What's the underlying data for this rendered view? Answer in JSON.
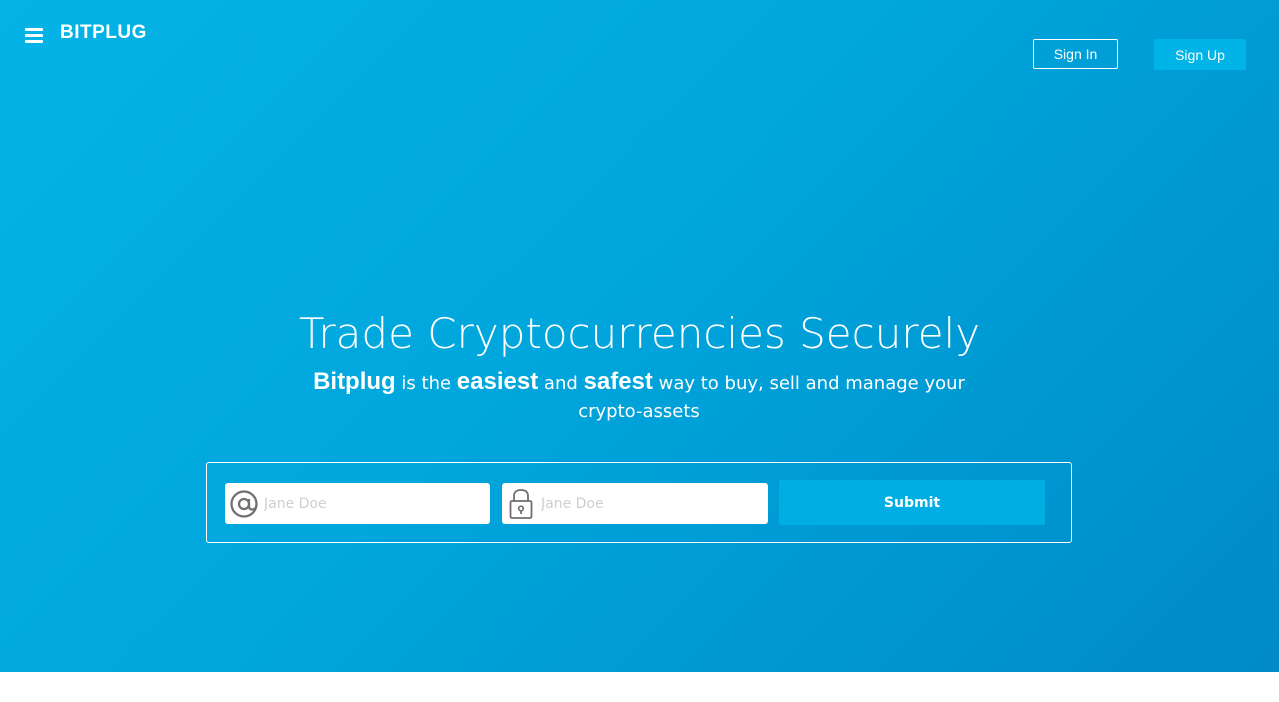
{
  "header": {
    "logo": "BITPLUG",
    "menu_icon": "hamburger-menu-icon",
    "sign_in_label": "Sign In",
    "sign_up_label": "Sign Up"
  },
  "hero": {
    "headline": "Trade Cryptocurrencies Securely",
    "subline": {
      "brand": "Bitplug",
      "part1": " is the ",
      "word_easiest": "easiest",
      "part2": " and ",
      "word_safest": "safest",
      "part3": " way to buy, sell and manage your crypto-assets"
    }
  },
  "form": {
    "email_icon": "at-sign-icon",
    "email_placeholder": "Jane Doe",
    "password_icon": "padlock-icon",
    "password_placeholder": "Jane Doe",
    "submit_label": "Submit"
  },
  "colors": {
    "hero_gradient_start": "#05b3e6",
    "hero_gradient_end": "#008ac8",
    "button_blue": "#00b4e8",
    "text": "#ffffff"
  }
}
